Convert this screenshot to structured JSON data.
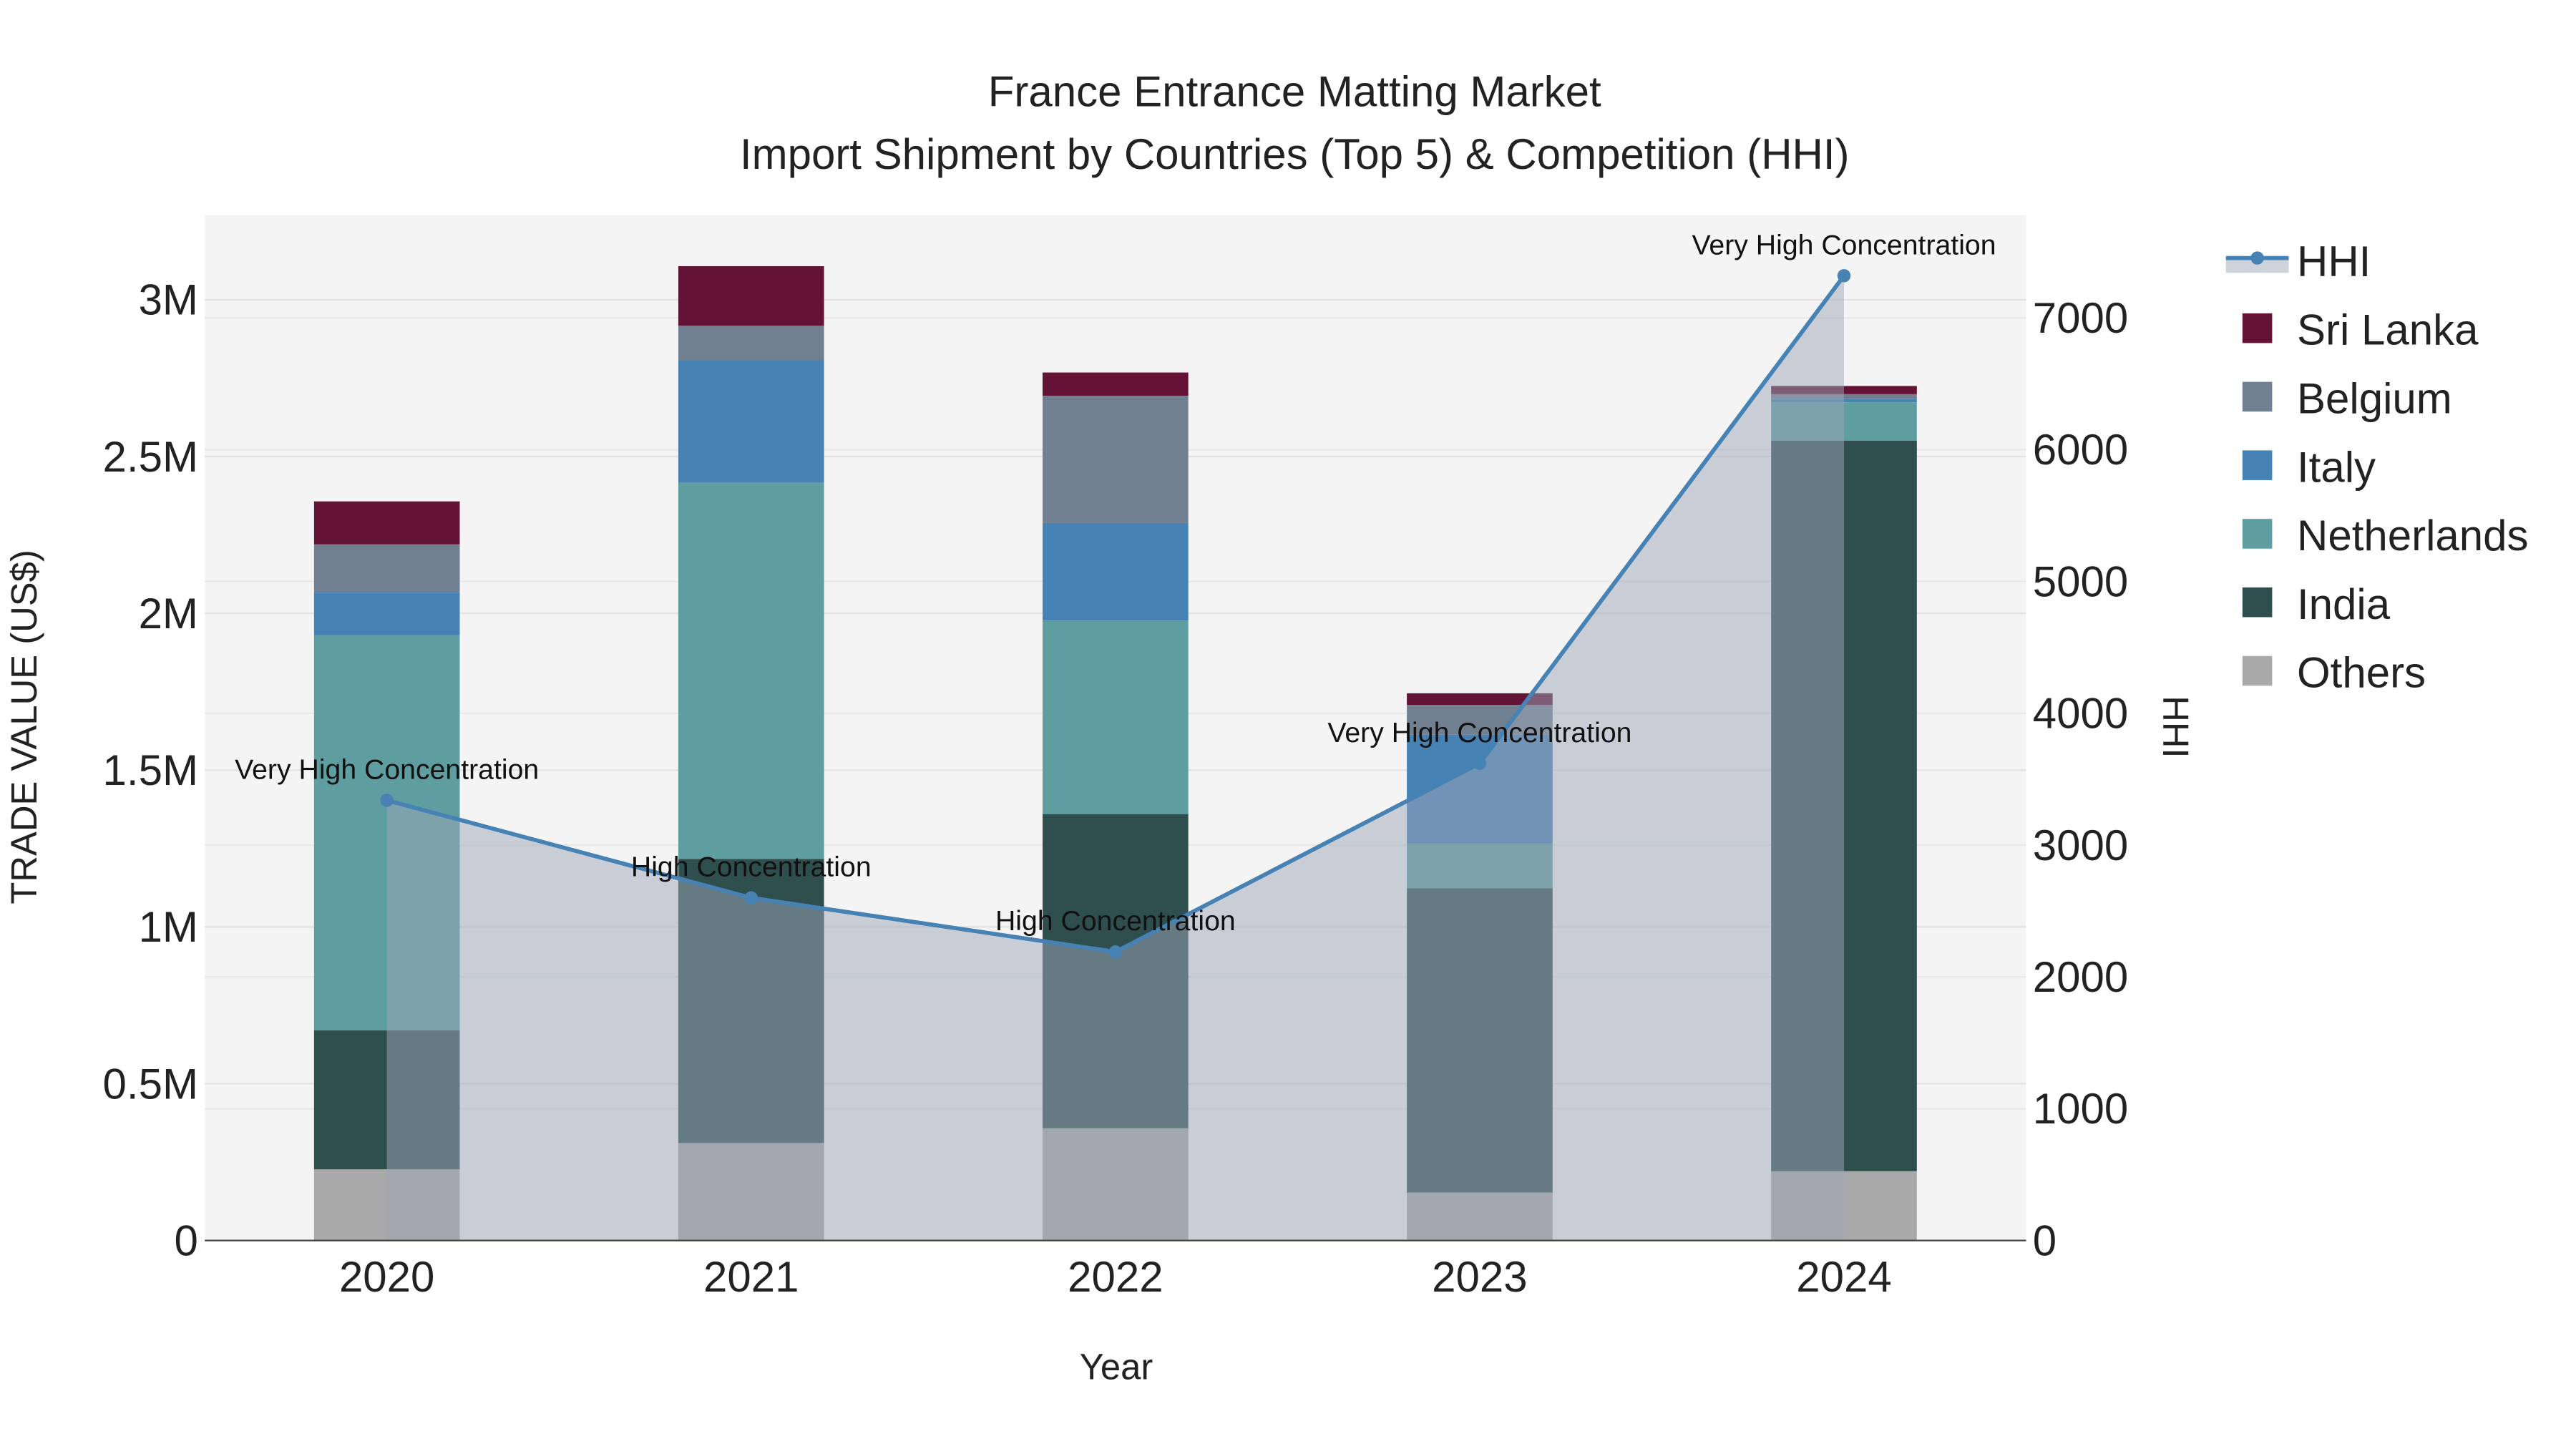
{
  "chart_data": {
    "type": "bar",
    "title": "France Entrance Matting Market",
    "subtitle": "Import Shipment by Countries (Top 5) & Competition (HHI)",
    "xlabel": "Year",
    "ylabel": "TRADE VALUE (US$)",
    "y2label": "HHI",
    "categories": [
      "2020",
      "2021",
      "2022",
      "2023",
      "2024"
    ],
    "ylim": [
      0,
      3270000
    ],
    "y2lim": [
      0,
      7780
    ],
    "yticks": [
      0,
      500000,
      1000000,
      1500000,
      2000000,
      2500000,
      3000000
    ],
    "ytick_labels": [
      "0",
      "0.5M",
      "1M",
      "1.5M",
      "2M",
      "2.5M",
      "3M"
    ],
    "y2ticks": [
      0,
      1000,
      2000,
      3000,
      4000,
      5000,
      6000,
      7000
    ],
    "y2tick_labels": [
      "0",
      "1000",
      "2000",
      "3000",
      "4000",
      "5000",
      "6000",
      "7000"
    ],
    "grid": true,
    "legend_position": "right",
    "series": [
      {
        "name": "Others",
        "color": "#a9a9a9",
        "values": [
          227000,
          311000,
          358000,
          153000,
          221000
        ]
      },
      {
        "name": "India",
        "color": "#2f4f4f",
        "values": [
          443000,
          906000,
          1002000,
          970000,
          2330000
        ]
      },
      {
        "name": "Netherlands",
        "color": "#5f9ea0",
        "values": [
          1260000,
          1200000,
          617000,
          142000,
          122000
        ]
      },
      {
        "name": "Italy",
        "color": "#4682b4",
        "values": [
          137000,
          390000,
          311000,
          348000,
          10000
        ]
      },
      {
        "name": "Belgium",
        "color": "#708090",
        "values": [
          153000,
          110000,
          406000,
          95000,
          16000
        ]
      },
      {
        "name": "Sri Lanka",
        "color": "#631335",
        "values": [
          137000,
          190000,
          74000,
          37000,
          26000
        ]
      }
    ],
    "hhi": {
      "name": "HHI",
      "color": "#4682b4",
      "values": [
        3340,
        2600,
        2190,
        3620,
        7320
      ],
      "annotations": [
        "Very High Concentration",
        "High Concentration",
        "High Concentration",
        "Very High Concentration",
        "Very High Concentration"
      ]
    },
    "legend_order": [
      "HHI",
      "Sri Lanka",
      "Belgium",
      "Italy",
      "Netherlands",
      "India",
      "Others"
    ]
  }
}
